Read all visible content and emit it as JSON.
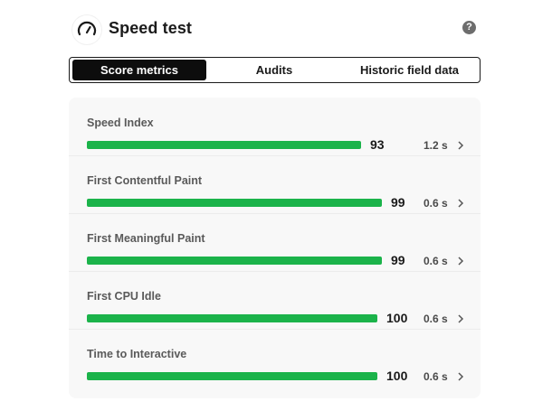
{
  "header": {
    "title": "Speed test",
    "logo_icon": "speedometer-icon",
    "help_icon": "help-icon",
    "help_glyph": "?"
  },
  "tabs": [
    {
      "label": "Score metrics",
      "active": true
    },
    {
      "label": "Audits",
      "active": false
    },
    {
      "label": "Historic field data",
      "active": false
    }
  ],
  "metrics": [
    {
      "name": "Speed Index",
      "score": "93",
      "score_fraction": 0.93,
      "time": "1.2 s"
    },
    {
      "name": "First Contentful Paint",
      "score": "99",
      "score_fraction": 0.99,
      "time": "0.6 s"
    },
    {
      "name": "First Meaningful Paint",
      "score": "99",
      "score_fraction": 0.99,
      "time": "0.6 s"
    },
    {
      "name": "First CPU Idle",
      "score": "100",
      "score_fraction": 1.0,
      "time": "0.6 s"
    },
    {
      "name": "Time to Interactive",
      "score": "100",
      "score_fraction": 1.0,
      "time": "0.6 s"
    }
  ],
  "colors": {
    "bar_good": "#1bb34a",
    "tab_active_bg": "#0d0d0d",
    "card_bg": "#f8f8f8"
  }
}
